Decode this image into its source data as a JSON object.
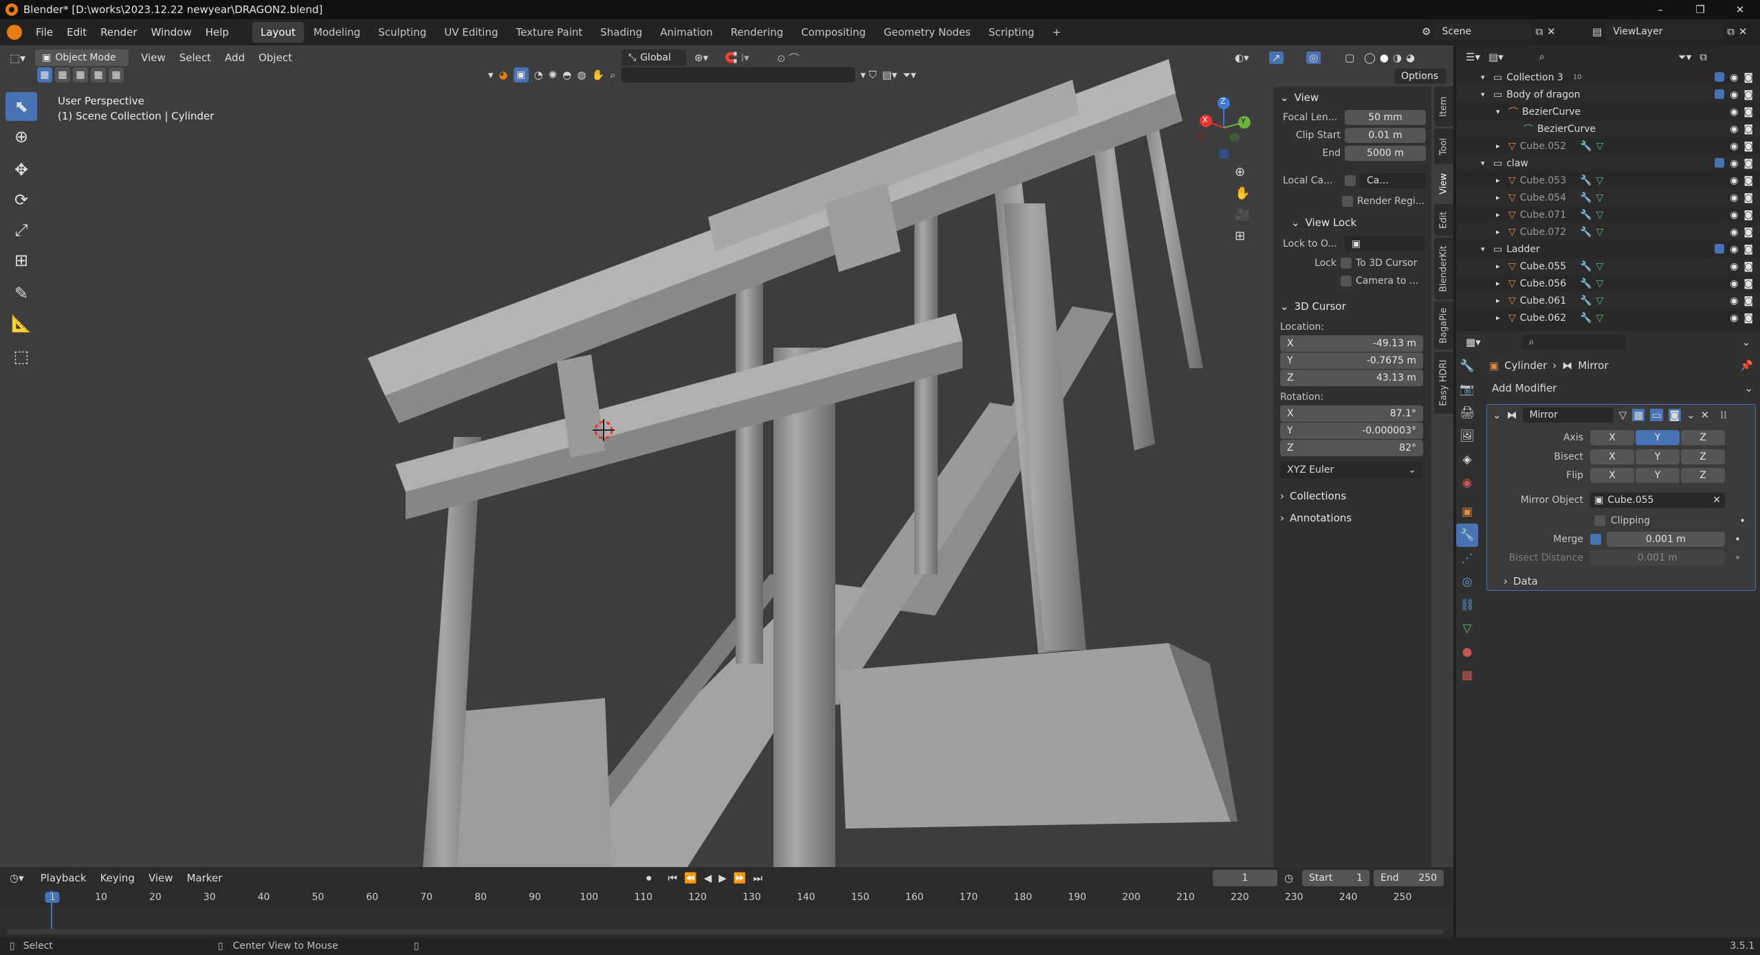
{
  "window": {
    "title": "Blender* [D:\\works\\2023.12.22 newyear\\DRAGON2.blend]",
    "controls": [
      "–",
      "❐",
      "✕"
    ]
  },
  "menubar": {
    "menus": [
      "File",
      "Edit",
      "Render",
      "Window",
      "Help"
    ],
    "workspaces": [
      "Layout",
      "Modeling",
      "Sculpting",
      "UV Editing",
      "Texture Paint",
      "Shading",
      "Animation",
      "Rendering",
      "Compositing",
      "Geometry Nodes",
      "Scripting"
    ],
    "active_workspace": "Layout",
    "add_tab": "+",
    "scene": "Scene",
    "view_layer": "ViewLayer"
  },
  "viewport": {
    "mode": "Object Mode",
    "menus": [
      "View",
      "Select",
      "Add",
      "Object"
    ],
    "transform_orientation": "Global",
    "options_label": "Options",
    "overlay_title": "User Perspective",
    "overlay_subtitle": "(1) Scene Collection | Cylinder",
    "gizmo_axes": {
      "x": "X",
      "y": "Y",
      "z": "Z"
    }
  },
  "npanel": {
    "tabs": [
      "Item",
      "Tool",
      "View",
      "Edit",
      "BlenderKit",
      "BagaPie",
      "Easy HDRI"
    ],
    "active_tab": "View",
    "view_section": "View",
    "focal_length_label": "Focal Len...",
    "focal_length": "50 mm",
    "clip_start_label": "Clip Start",
    "clip_start": "0.01 m",
    "clip_end_label": "End",
    "clip_end": "5000 m",
    "local_camera_label": "Local Ca...",
    "local_camera_value": "Ca...",
    "render_region_label": "Render Regi...",
    "view_lock_section": "View Lock",
    "lock_to_object_label": "Lock to O...",
    "lock_label": "Lock",
    "to_3d_cursor_label": "To 3D Cursor",
    "camera_to_label": "Camera to ...",
    "cursor_section": "3D Cursor",
    "location_label": "Location:",
    "loc_x": "-49.13 m",
    "loc_y": "-0.7675 m",
    "loc_z": "43.13 m",
    "rotation_label": "Rotation:",
    "rot_x": "87.1°",
    "rot_y": "-0.000003°",
    "rot_z": "82°",
    "rotation_mode": "XYZ Euler",
    "collections_section": "Collections",
    "annotations_section": "Annotations",
    "axis_x": "X",
    "axis_y": "Y",
    "axis_z": "Z"
  },
  "outliner": {
    "rows": [
      {
        "name": "Collection 3",
        "indent": 1,
        "kind": "collection",
        "badge": "10"
      },
      {
        "name": "Body of dragon",
        "indent": 1,
        "kind": "collection"
      },
      {
        "name": "BezierCurve",
        "indent": 2,
        "kind": "curve"
      },
      {
        "name": "BezierCurve",
        "indent": 3,
        "kind": "curve-data"
      },
      {
        "name": "Cube.052",
        "indent": 2,
        "kind": "mesh"
      },
      {
        "name": "claw",
        "indent": 1,
        "kind": "collection"
      },
      {
        "name": "Cube.053",
        "indent": 2,
        "kind": "mesh"
      },
      {
        "name": "Cube.054",
        "indent": 2,
        "kind": "mesh"
      },
      {
        "name": "Cube.071",
        "indent": 2,
        "kind": "mesh"
      },
      {
        "name": "Cube.072",
        "indent": 2,
        "kind": "mesh"
      },
      {
        "name": "Ladder",
        "indent": 1,
        "kind": "collection"
      },
      {
        "name": "Cube.055",
        "indent": 2,
        "kind": "mesh"
      },
      {
        "name": "Cube.056",
        "indent": 2,
        "kind": "mesh"
      },
      {
        "name": "Cube.061",
        "indent": 2,
        "kind": "mesh"
      },
      {
        "name": "Cube.062",
        "indent": 2,
        "kind": "mesh"
      }
    ]
  },
  "properties": {
    "breadcrumb_object": "Cylinder",
    "breadcrumb_modifier": "Mirror",
    "add_modifier": "Add Modifier",
    "modifier_name": "Mirror",
    "axis_label": "Axis",
    "bisect_label": "Bisect",
    "flip_label": "Flip",
    "axes": [
      "X",
      "Y",
      "Z"
    ],
    "active_axis": "Y",
    "mirror_object_label": "Mirror Object",
    "mirror_object": "Cube.055",
    "clipping_label": "Clipping",
    "merge_label": "Merge",
    "merge_value": "0.001 m",
    "bisect_distance_label": "Bisect Distance",
    "bisect_distance_value": "0.001 m",
    "data_section": "Data"
  },
  "timeline": {
    "menus": [
      "Playback",
      "Keying",
      "View",
      "Marker"
    ],
    "current_frame": "1",
    "start_label": "Start",
    "start": "1",
    "end_label": "End",
    "end": "250",
    "ticks": [
      "1",
      "10",
      "20",
      "30",
      "40",
      "50",
      "60",
      "70",
      "80",
      "90",
      "100",
      "110",
      "120",
      "130",
      "140",
      "150",
      "160",
      "170",
      "180",
      "190",
      "200",
      "210",
      "220",
      "230",
      "240",
      "250"
    ]
  },
  "statusbar": {
    "select_hint": "Select",
    "center_hint": "Center View to Mouse",
    "version": "3.5.1"
  },
  "colors": {
    "accent": "#4772b3",
    "viewport_bg": "#3d3d3d",
    "panel_bg": "#303030",
    "mesh_orange": "#e08b3c",
    "data_green": "#5fb37e"
  }
}
